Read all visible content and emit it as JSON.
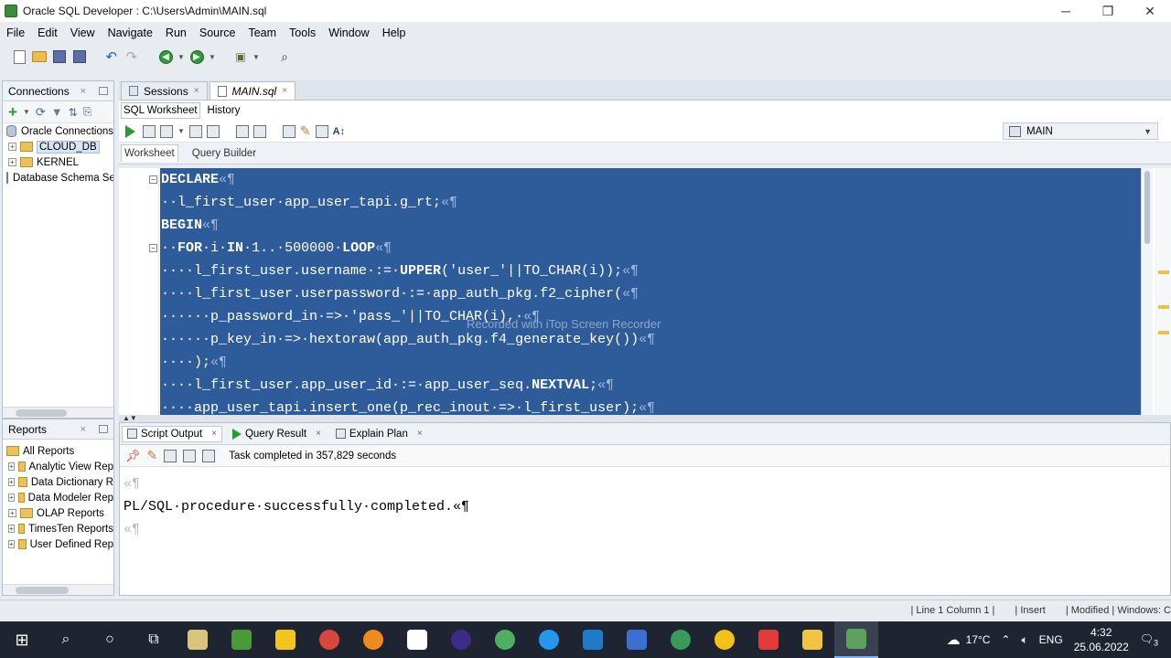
{
  "window": {
    "title": "Oracle SQL Developer : C:\\Users\\Admin\\MAIN.sql",
    "minimize": "─",
    "maximize": "❐",
    "close": "✕"
  },
  "menu": [
    "File",
    "Edit",
    "View",
    "Navigate",
    "Run",
    "Source",
    "Team",
    "Tools",
    "Window",
    "Help"
  ],
  "connections_pane": {
    "tab_label": "Connections",
    "close": "×",
    "tree": [
      {
        "label": "Oracle Connections",
        "type": "root"
      },
      {
        "label": "CLOUD_DB",
        "type": "folder",
        "selected": true
      },
      {
        "label": "KERNEL",
        "type": "folder"
      },
      {
        "label": "Database Schema Ser",
        "type": "root"
      }
    ]
  },
  "reports_pane": {
    "tab_label": "Reports",
    "close": "×",
    "tree": [
      "All Reports",
      "Analytic View Rep",
      "Data Dictionary R",
      "Data Modeler Rep",
      "OLAP Reports",
      "TimesTen Reports",
      "User Defined Rep"
    ]
  },
  "doc_tabs": [
    {
      "label": "Sessions",
      "active": false,
      "close": "×"
    },
    {
      "label": "MAIN.sql",
      "active": true,
      "close": "×"
    }
  ],
  "sub_tabs": [
    "SQL Worksheet",
    "History"
  ],
  "connection_select": "MAIN",
  "inner_tabs": [
    "Worksheet",
    "Query Builder"
  ],
  "code_lines": [
    [
      {
        "t": "DECLARE",
        "k": 1
      },
      {
        "t": "«¶",
        "p": 1
      }
    ],
    [
      {
        "t": "··l_first_user·app_user_tapi.g_rt;"
      },
      {
        "t": "«¶",
        "p": 1
      }
    ],
    [
      {
        "t": "BEGIN",
        "k": 1
      },
      {
        "t": "«¶",
        "p": 1
      }
    ],
    [
      {
        "t": "··"
      },
      {
        "t": "FOR",
        "k": 1
      },
      {
        "t": "·i·"
      },
      {
        "t": "IN",
        "k": 1
      },
      {
        "t": "·1..·500000·"
      },
      {
        "t": "LOOP",
        "k": 1
      },
      {
        "t": "«¶",
        "p": 1
      }
    ],
    [
      {
        "t": "····l_first_user.username·:=·"
      },
      {
        "t": "UPPER",
        "k": 1
      },
      {
        "t": "('user_'||TO_CHAR(i));"
      },
      {
        "t": "«¶",
        "p": 1
      }
    ],
    [
      {
        "t": "····l_first_user.userpassword·:=·app_auth_pkg.f2_cipher("
      },
      {
        "t": "«¶",
        "p": 1
      }
    ],
    [
      {
        "t": "······p_password_in·=>·'pass_'||TO_CHAR(i),·"
      },
      {
        "t": "«¶",
        "p": 1
      }
    ],
    [
      {
        "t": "······p_key_in·=>·hextoraw(app_auth_pkg.f4_generate_key())"
      },
      {
        "t": "«¶",
        "p": 1
      }
    ],
    [
      {
        "t": "····);"
      },
      {
        "t": "«¶",
        "p": 1
      }
    ],
    [
      {
        "t": "····l_first_user.app_user_id·:=·app_user_seq."
      },
      {
        "t": "NEXTVAL",
        "k": 1
      },
      {
        "t": ";"
      },
      {
        "t": "«¶",
        "p": 1
      }
    ],
    [
      {
        "t": "····app_user_tapi.insert_one(p_rec_inout·=>·l_first_user);"
      },
      {
        "t": "«¶",
        "p": 1
      }
    ]
  ],
  "watermark": "Recorded with iTop Screen Recorder",
  "output_tabs": [
    {
      "label": "Script Output",
      "active": true,
      "close": "×"
    },
    {
      "label": "Query Result",
      "active": false,
      "close": "×"
    },
    {
      "label": "Explain Plan",
      "active": false,
      "close": "×"
    }
  ],
  "task_status": "Task completed in 357,829 seconds",
  "output_lines": [
    "«¶",
    "PL/SQL·procedure·successfully·completed.«¶",
    "«¶"
  ],
  "statusbar": [
    "| Line 1 Column 1 |",
    "| Insert",
    "| Modified | Windows: C"
  ],
  "taskbar": {
    "temperature": "17°C",
    "language": "ENG",
    "time": "4:32",
    "date": "25.06.2022",
    "notifications": "3"
  }
}
